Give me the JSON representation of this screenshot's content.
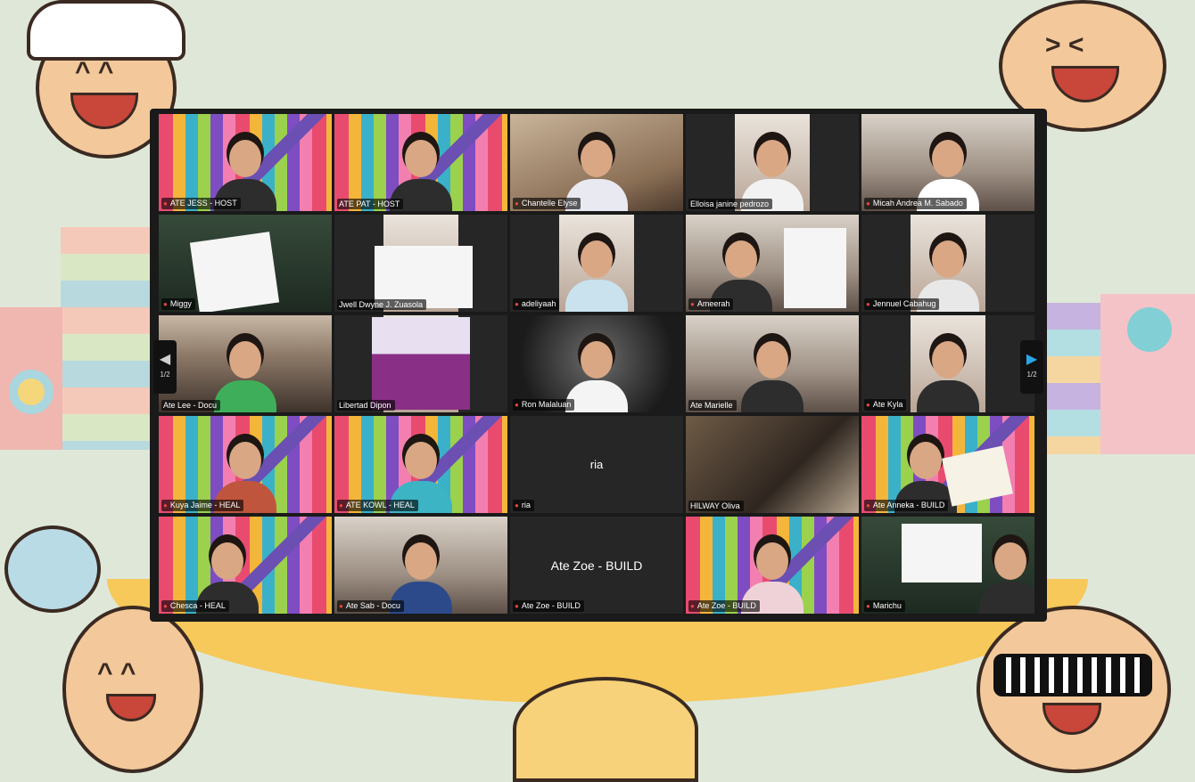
{
  "meeting": {
    "page_indicator_left": "1/2",
    "page_indicator_right": "1/2",
    "tiles": [
      {
        "name": "ATE JESS - HOST",
        "muted": true
      },
      {
        "name": "ATE PAT - HOST",
        "muted": false
      },
      {
        "name": "Chantelle Elyse",
        "muted": true
      },
      {
        "name": "Elloisa janine pedrozo",
        "muted": false
      },
      {
        "name": "Micah Andrea M. Sabado",
        "muted": true
      },
      {
        "name": "Miggy",
        "muted": true
      },
      {
        "name": "Jwell Dwyne J. Zuasola",
        "muted": false
      },
      {
        "name": "adeliyaah",
        "muted": true
      },
      {
        "name": "Ameerah",
        "muted": true
      },
      {
        "name": "Jennuel Cabahug",
        "muted": true
      },
      {
        "name": "Ate Lee - Docu",
        "muted": false
      },
      {
        "name": "Libertad Dipon",
        "muted": false
      },
      {
        "name": "Ron Malaluan",
        "muted": true
      },
      {
        "name": "Ate Marielle",
        "muted": false
      },
      {
        "name": "Ate Kyla",
        "muted": true
      },
      {
        "name": "Kuya Jaime - HEAL",
        "muted": true
      },
      {
        "name": "ATE KOWL - HEAL",
        "muted": true
      },
      {
        "name": "ria",
        "muted": true,
        "video_off_label": "ria"
      },
      {
        "name": "HILWAY Oliva",
        "muted": false
      },
      {
        "name": "Ate Anneka - BUILD",
        "muted": true
      },
      {
        "name": "Chesca - HEAL",
        "muted": true
      },
      {
        "name": "Ate Sab - Docu",
        "muted": true
      },
      {
        "name": "Ate Zoe - BUILD",
        "muted": true,
        "video_off_label": "Ate Zoe - BUILD"
      },
      {
        "name": "Ate Zoe - BUILD",
        "muted": true
      },
      {
        "name": "Marichu",
        "muted": true
      }
    ]
  },
  "icons": {
    "mic_off": "microphone-muted-icon",
    "prev": "chevron-left-icon",
    "next": "chevron-right-icon"
  },
  "colors": {
    "background": "#dfe8d8",
    "frame": "#1a1a1a",
    "accent_next": "#2aa6e6",
    "muted_red": "#e5463e"
  }
}
